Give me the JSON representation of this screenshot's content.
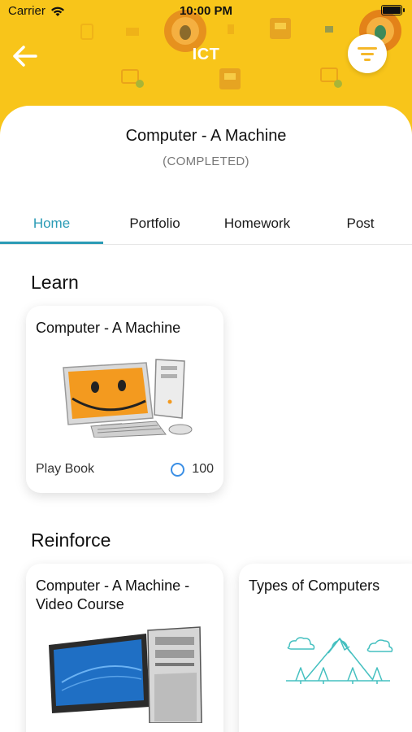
{
  "status_bar": {
    "carrier": "Carrier",
    "time": "10:00 PM"
  },
  "header": {
    "title": "ICT",
    "background": "#f8c51a"
  },
  "chapter": {
    "title": "Computer - A Machine",
    "status": "(COMPLETED)"
  },
  "tabs": [
    {
      "label": "Home",
      "active": true
    },
    {
      "label": "Portfolio",
      "active": false
    },
    {
      "label": "Homework",
      "active": false
    },
    {
      "label": "Post",
      "active": false
    }
  ],
  "learn": {
    "heading": "Learn",
    "cards": [
      {
        "title": "Computer - A Machine",
        "footer_label": "Play Book",
        "score": "100",
        "icon": "smiley-computer-illustration"
      }
    ]
  },
  "reinforce": {
    "heading": "Reinforce",
    "cards": [
      {
        "title": "Computer - A Machine - Video Course",
        "icon": "desktop-computer-illustration"
      },
      {
        "title": "Types of Computers",
        "icon": "mountain-placeholder-illustration"
      }
    ]
  },
  "colors": {
    "accent": "#2a9bb5",
    "header": "#f8c51a",
    "score_ring": "#3b8fe5"
  }
}
